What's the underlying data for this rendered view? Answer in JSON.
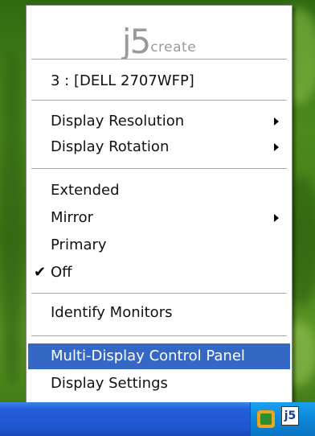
{
  "logo": {
    "main": "j5",
    "sub": "create"
  },
  "menu": {
    "monitor_label": "3 : [DELL 2707WFP]",
    "items": [
      {
        "label": "Display Resolution",
        "has_submenu": true
      },
      {
        "label": "Display Rotation",
        "has_submenu": true
      },
      {
        "label": "Extended",
        "has_submenu": false
      },
      {
        "label": "Mirror",
        "has_submenu": true
      },
      {
        "label": "Primary",
        "has_submenu": false
      },
      {
        "label": "Off",
        "checked": true
      },
      {
        "label": "Identify Monitors"
      },
      {
        "label": "Multi-Display Control Panel",
        "highlighted": true
      },
      {
        "label": "Display Settings"
      }
    ],
    "check_glyph": "✔"
  },
  "taskbar": {
    "tray_icons": [
      "j5create-tray-icon",
      "network-tray-icon"
    ],
    "tray_glyph": "j5"
  },
  "colors": {
    "highlight": "#3468c4",
    "taskbar": "#245edb",
    "logo": "#9a9a9a"
  }
}
